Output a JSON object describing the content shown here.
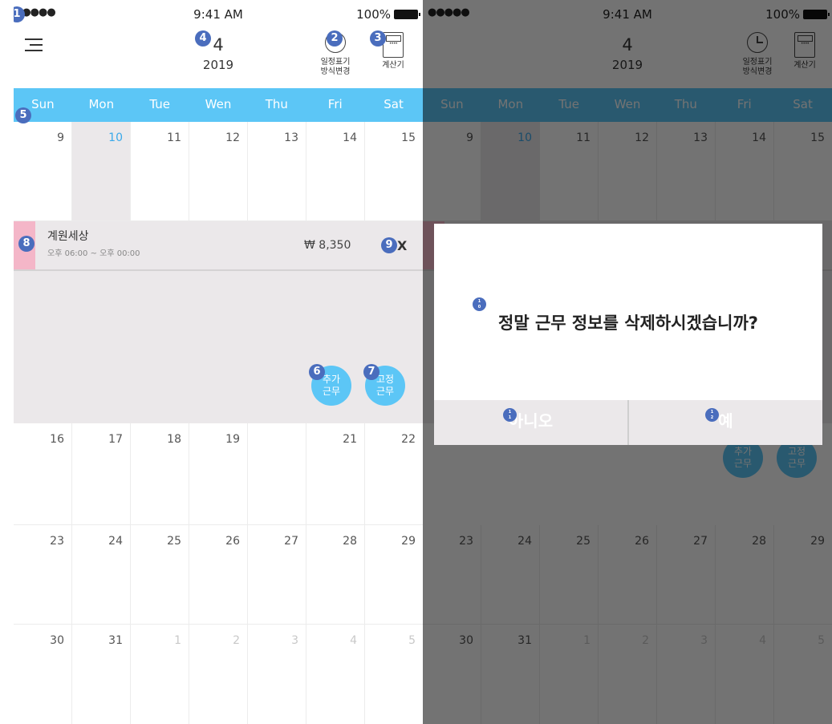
{
  "status_bar": {
    "signal": "●●●●●",
    "time": "9:41 AM",
    "battery": "100%"
  },
  "header": {
    "month": "4",
    "year": "2019",
    "view_toggle_label": "일정표기 방식변경",
    "calculator_label": "계산기"
  },
  "weekdays": [
    "Sun",
    "Mon",
    "Tue",
    "Wen",
    "Thu",
    "Fri",
    "Sat"
  ],
  "weeks": [
    [
      "9",
      "10",
      "11",
      "12",
      "13",
      "14",
      "15"
    ],
    [
      "16",
      "17",
      "18",
      "19",
      "",
      "21",
      "22"
    ],
    [
      "23",
      "24",
      "25",
      "26",
      "27",
      "28",
      "29"
    ],
    [
      "30",
      "31",
      "1",
      "2",
      "3",
      "4",
      "5"
    ]
  ],
  "event": {
    "title": "계원세상",
    "time": "오후 06:00 ~ 오후 00:00",
    "wage": "₩ 8,350",
    "delete": "X",
    "color": "#f4b6c8"
  },
  "fab": {
    "add_shift": "추가\n근무",
    "fixed_shift": "고정\n근무"
  },
  "dialog": {
    "message": "정말 근무 정보를 삭제하시겠습니까?",
    "no": "아니오",
    "yes": "예"
  },
  "badges": {
    "b1": "1",
    "b2": "2",
    "b3": "3",
    "b4": "4",
    "b5": "5",
    "b6": "6",
    "b7": "7",
    "b8": "8",
    "b9": "9",
    "b10": "1\n0",
    "b11": "1\n1",
    "b12": "1\n2"
  },
  "colors": {
    "accent": "#5cc6f6",
    "badge": "#4a6dbd",
    "selected_bg": "#ebe8ea",
    "event_color": "#f4b6c8"
  }
}
